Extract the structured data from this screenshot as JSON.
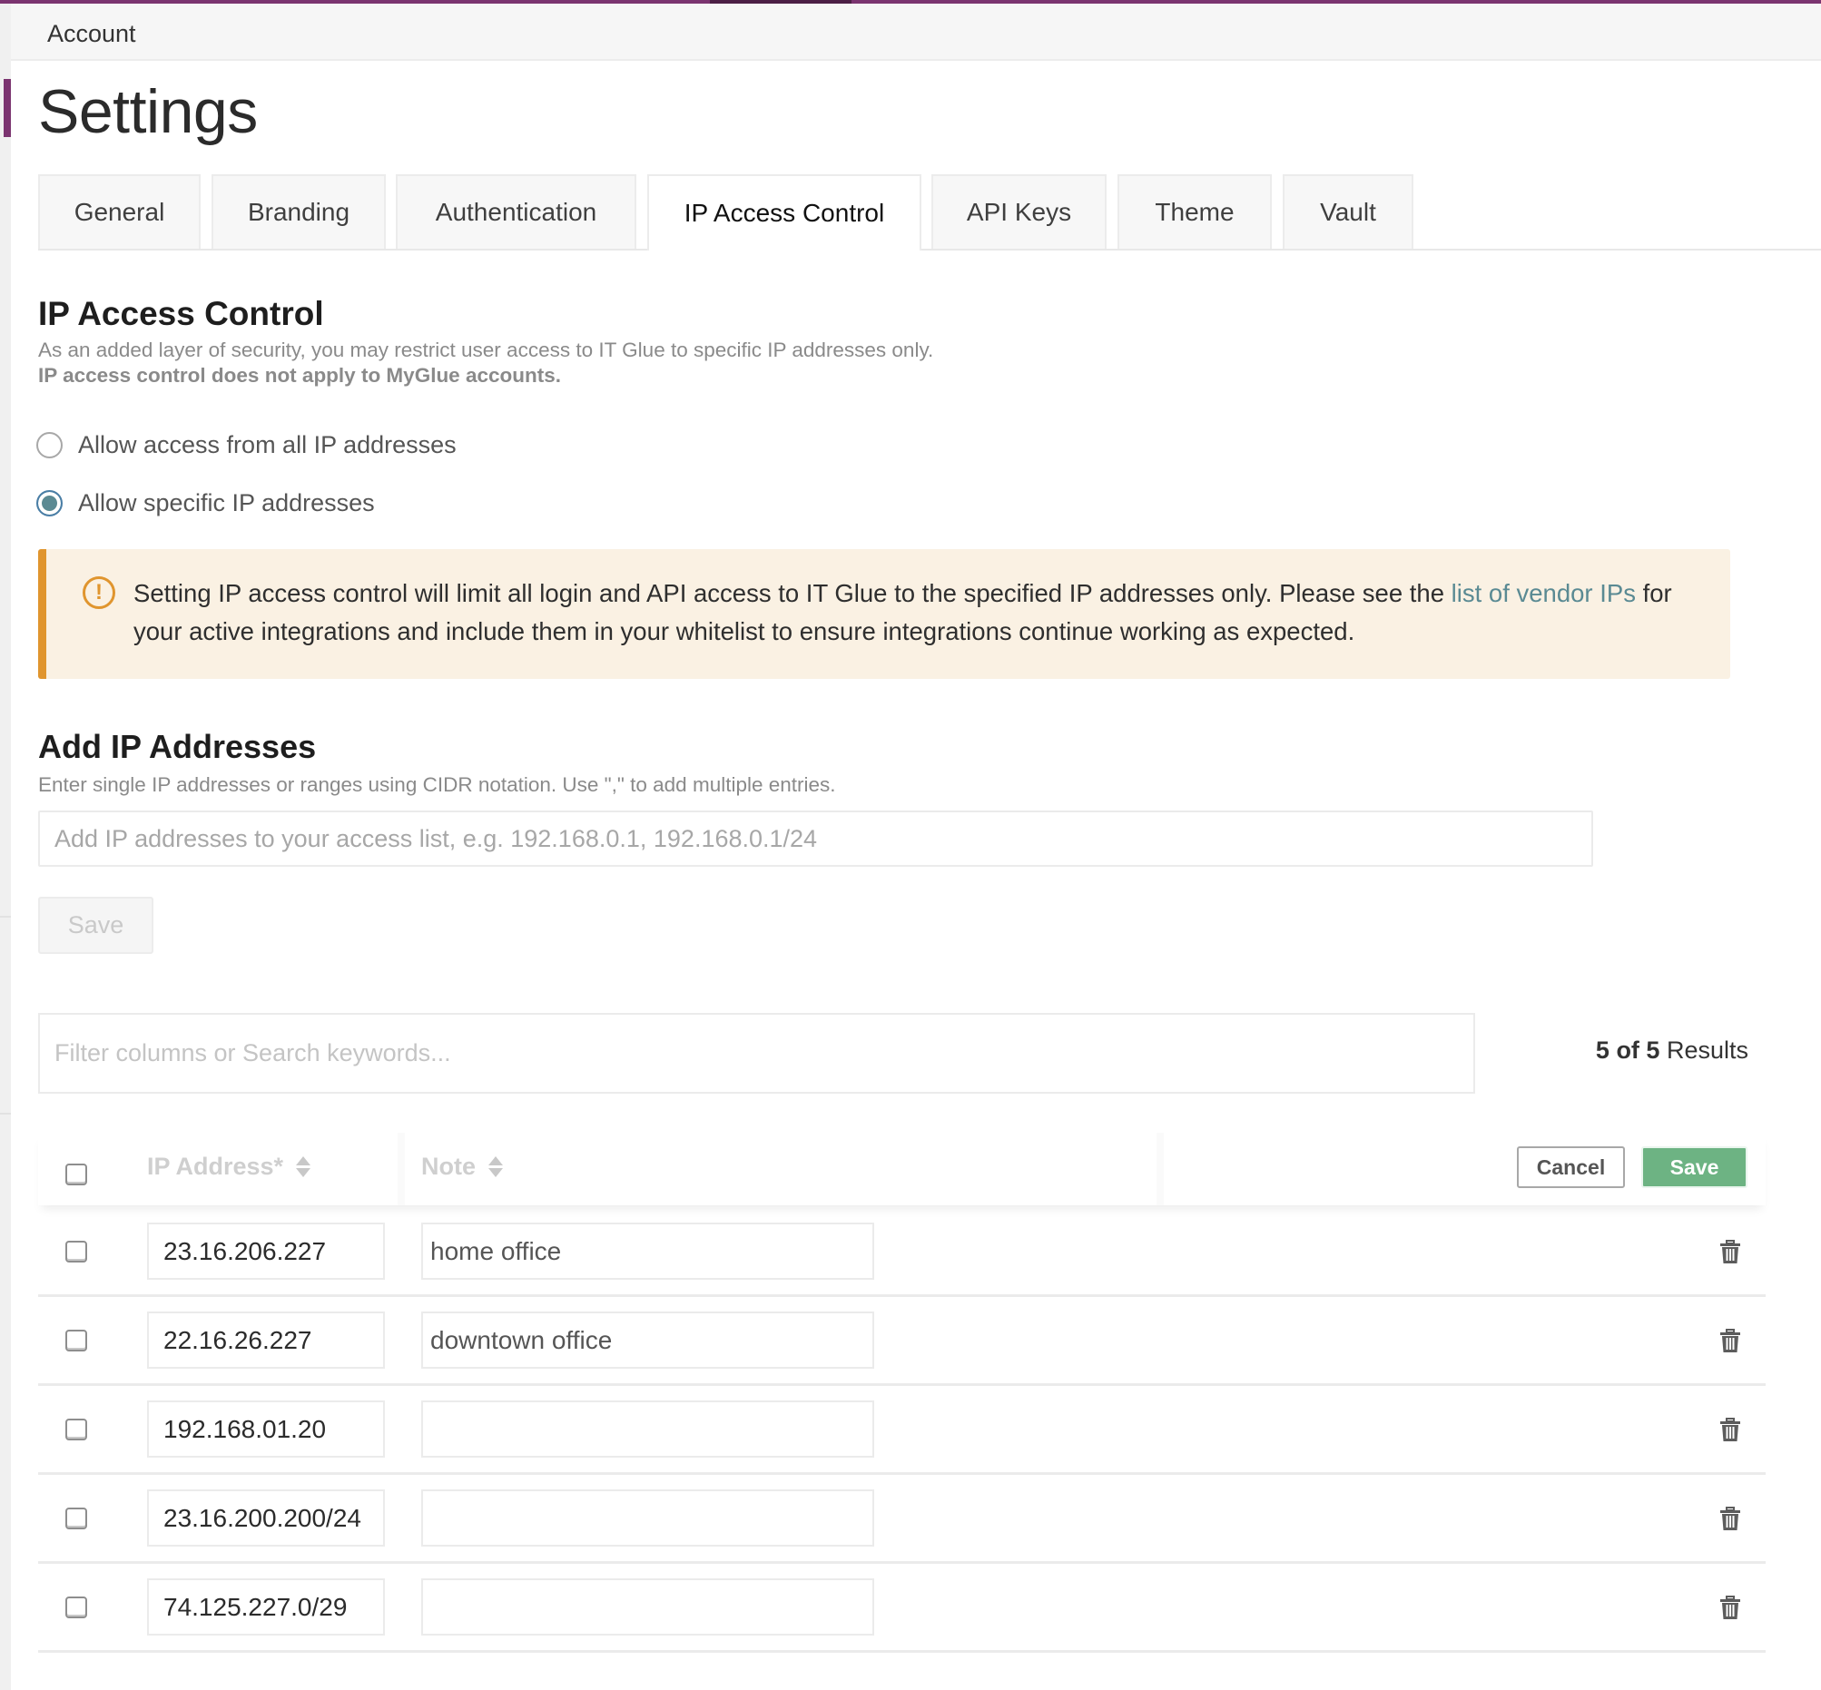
{
  "header": {
    "breadcrumb": "Account"
  },
  "page": {
    "title": "Settings"
  },
  "colors": {
    "brand": "#7b3470",
    "accent_link": "#5a8a93",
    "warning": "#e0952e",
    "warning_bg": "#faf1e3",
    "save_green": "#6db383"
  },
  "tabs": [
    {
      "label": "General",
      "active": false
    },
    {
      "label": "Branding",
      "active": false
    },
    {
      "label": "Authentication",
      "active": false
    },
    {
      "label": "IP Access Control",
      "active": true
    },
    {
      "label": "API Keys",
      "active": false
    },
    {
      "label": "Theme",
      "active": false
    },
    {
      "label": "Vault",
      "active": false
    }
  ],
  "section": {
    "title": "IP Access Control",
    "desc_line1": "As an added layer of security, you may restrict user access to IT Glue to specific IP addresses only.",
    "desc_line2": "IP access control does not apply to MyGlue accounts."
  },
  "access_mode": {
    "options": [
      {
        "label": "Allow access from all IP addresses",
        "checked": false
      },
      {
        "label": "Allow specific IP addresses",
        "checked": true
      }
    ]
  },
  "alert": {
    "icon": "exclamation-circle-icon",
    "text_before": "Setting IP access control will limit all login and API access to IT Glue to the specified IP addresses only. Please see the ",
    "link": "list of vendor IPs",
    "text_after": " for your active integrations and include them in your whitelist to ensure integrations continue working as expected."
  },
  "add_ip": {
    "title": "Add IP Addresses",
    "desc": "Enter single IP addresses or ranges using CIDR notation. Use \",\" to add multiple entries.",
    "placeholder": "Add IP addresses to your access list, e.g. 192.168.0.1, 192.168.0.1/24",
    "value": "",
    "save_label": "Save"
  },
  "table": {
    "filter_placeholder": "Filter columns or Search keywords...",
    "results_count": "5 of 5",
    "results_suffix": " Results",
    "columns": [
      {
        "label": "IP Address*",
        "sortable": true
      },
      {
        "label": "Note",
        "sortable": true
      }
    ],
    "cancel_label": "Cancel",
    "save_label": "Save",
    "rows": [
      {
        "ip": "23.16.206.227",
        "note": "home office",
        "checked": false
      },
      {
        "ip": "22.16.26.227",
        "note": "downtown office",
        "checked": false
      },
      {
        "ip": "192.168.01.20",
        "note": "",
        "checked": false
      },
      {
        "ip": "23.16.200.200/24",
        "note": "",
        "checked": false
      },
      {
        "ip": "74.125.227.0/29",
        "note": "",
        "checked": false
      }
    ]
  }
}
